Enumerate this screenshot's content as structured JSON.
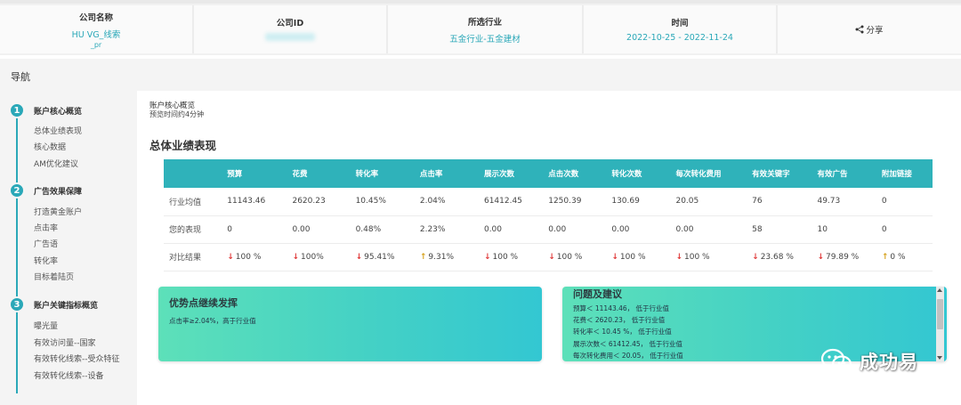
{
  "header": {
    "company_name_label": "公司名称",
    "company_name_value": "HU                       VG_线索",
    "company_name_sub": "_pr",
    "company_id_label": "公司ID",
    "company_id_value": "          ",
    "industry_label": "所选行业",
    "industry_value": "五金行业-五金建材",
    "time_label": "时间",
    "time_value": "2022-10-25 - 2022-11-24",
    "share_label": "分享",
    "share_icon": "share-icon"
  },
  "nav": {
    "title": "导航"
  },
  "sidebar": {
    "sections": [
      {
        "num": "1",
        "title": "账户核心概览",
        "items": [
          "总体业绩表现",
          "核心数据",
          "AM优化建议"
        ]
      },
      {
        "num": "2",
        "title": "广告效果保障",
        "items": [
          "打造黄金账户",
          "点击率",
          "广告语",
          "转化率",
          "目标着陆页"
        ]
      },
      {
        "num": "3",
        "title": "账户关键指标概览",
        "items": [
          "曝光量",
          "有效访问量--国家",
          "有效转化线索--受众特征",
          "有效转化线索--设备"
        ]
      }
    ]
  },
  "main": {
    "breadcrumb": "账户核心概览",
    "read_time": "预览时间约4分钟",
    "section_title": "总体业绩表现",
    "table": {
      "headers": [
        "",
        "预算",
        "花费",
        "转化率",
        "点击率",
        "展示次数",
        "点击次数",
        "转化次数",
        "每次转化费用",
        "有效关键字",
        "有效广告",
        "附加链接"
      ],
      "rows": [
        {
          "label": "行业均值",
          "cells": [
            "11143.46",
            "2620.23",
            "10.45%",
            "2.04%",
            "61412.45",
            "1250.39",
            "130.69",
            "20.05",
            "76",
            "49.73",
            "0"
          ]
        },
        {
          "label": "您的表现",
          "cells": [
            "0",
            "0.00",
            "0.48%",
            "2.23%",
            "0.00",
            "0.00",
            "0.00",
            "0.00",
            "58",
            "10",
            "0"
          ]
        },
        {
          "label": "对比结果",
          "cells": [
            "100 %",
            "100%",
            "95.41%",
            "9.31%",
            "100 %",
            "100 %",
            "100 %",
            "100 %",
            "23.68 %",
            "79.89 %",
            "0 %"
          ],
          "directions": [
            "down",
            "down",
            "down",
            "up",
            "down",
            "down",
            "down",
            "down",
            "down",
            "down",
            "up"
          ]
        }
      ]
    },
    "advantage_card": {
      "title": "优势点继续发挥",
      "text": "点击率≥2.04%，高于行业值"
    },
    "issues_card": {
      "title": "问题及建议",
      "items": [
        "预算＜ 11143.46， 低于行业值",
        "花费＜ 2620.23， 低于行业值",
        "转化率＜ 10.45 %， 低于行业值",
        "展示次数＜ 61412.45， 低于行业值",
        "每次转化费用＜ 20.05， 低于行业值"
      ]
    }
  },
  "watermark": {
    "text": "成功易",
    "icon": "wechat-icon"
  },
  "colors": {
    "accent": "#2aa8b8",
    "table_header": "#2fb2ba",
    "down": "#e03a3a",
    "up": "#d6a21e"
  }
}
